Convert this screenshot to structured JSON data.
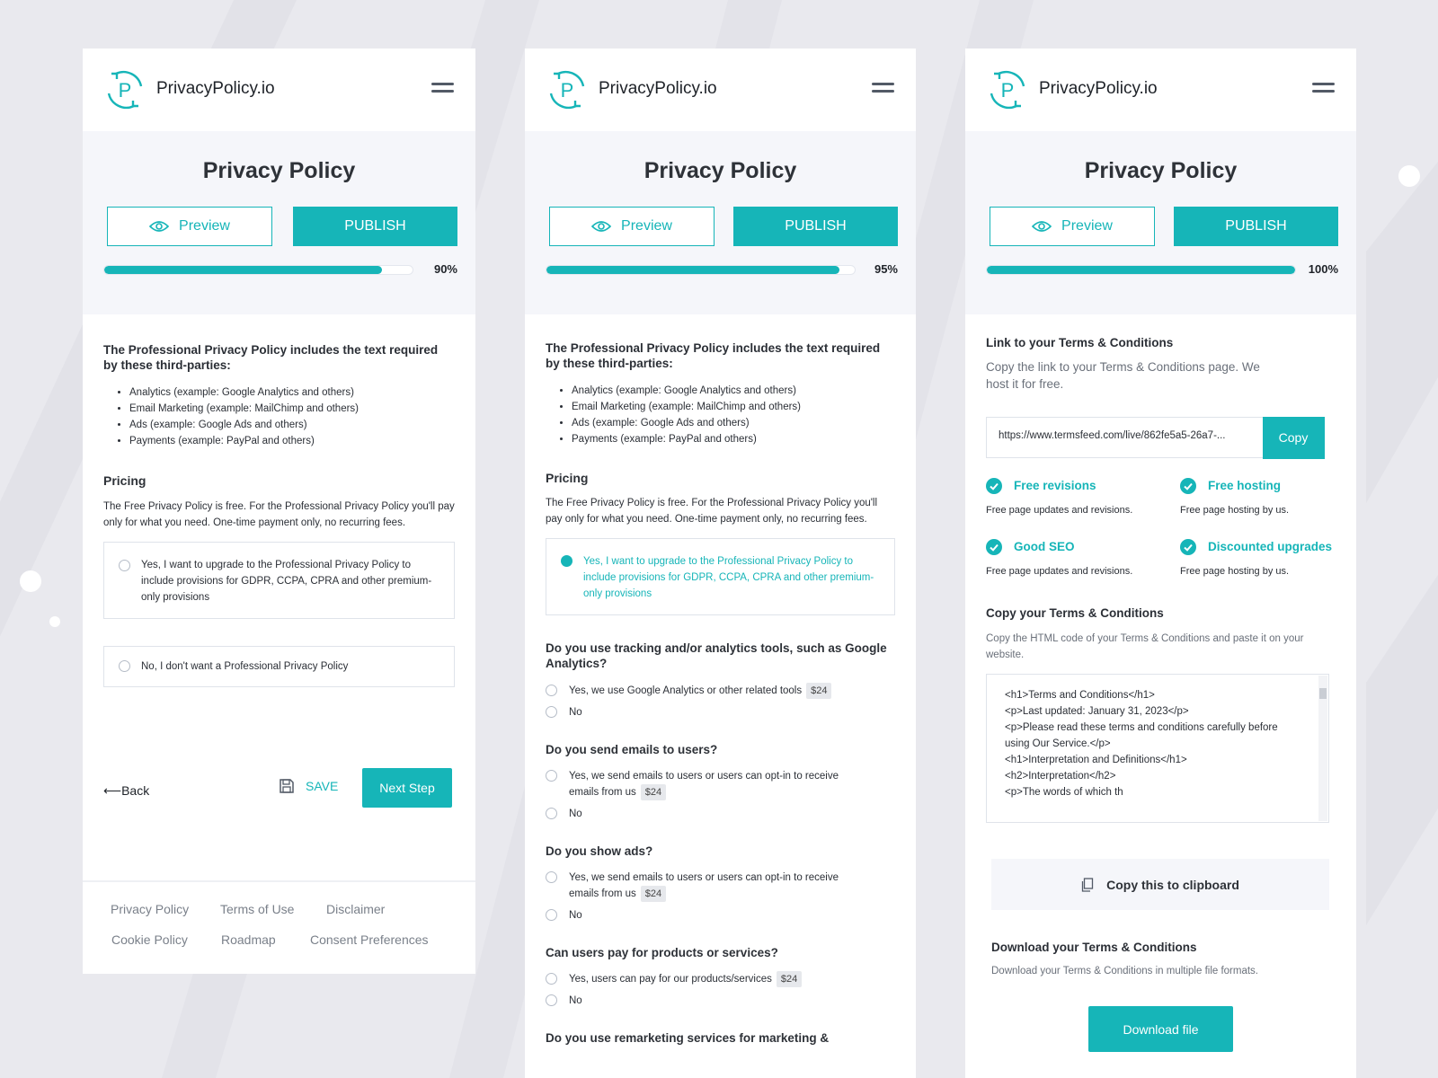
{
  "brand": "PrivacyPolicy.io",
  "colors": {
    "accent": "#16b5b8",
    "background": "#e9e9ee",
    "header_bg": "#f5f6fa"
  },
  "icons": [
    "logo-p-cycle",
    "hamburger-menu",
    "eye-icon",
    "save-disk-icon",
    "back-arrow",
    "check-circle",
    "clipboard-icon"
  ],
  "page_title": "Privacy Policy",
  "preview_label": "Preview",
  "publish_label": "PUBLISH",
  "screen1": {
    "progress": {
      "value": 90,
      "label": "90%"
    },
    "intro": "The Professional Privacy Policy includes the text required by these third-parties:",
    "third_parties": [
      "Analytics (example: Google Analytics and others)",
      "Email Marketing (example: MailChimp and others)",
      "Ads (example: Google Ads and others)",
      "Payments (example: PayPal and others)"
    ],
    "pricing_title": "Pricing",
    "pricing_text": "The Free Privacy Policy is free. For the Professional Privacy Policy you'll pay only for what you need. One-time payment only, no recurring fees.",
    "option_yes": "Yes, I want to upgrade to the Professional Privacy Policy to include provisions for GDPR, CCPA, CPRA and other premium-only provisions",
    "option_no": "No, I don't want a Professional Privacy Policy",
    "back_label": "Back",
    "back_arrow": "⟵",
    "save_label": "SAVE",
    "next_label": "Next Step",
    "footer_links": [
      "Privacy Policy",
      "Terms of Use",
      "Disclaimer",
      "Cookie Policy",
      "Roadmap",
      "Consent Preferences"
    ]
  },
  "screen2": {
    "progress": {
      "value": 95,
      "label": "95%"
    },
    "selected_option": "Yes, I want to upgrade to the Professional Privacy Policy to include provisions for GDPR, CCPA, CPRA and other premium-only provisions",
    "questions": [
      {
        "q": "Do you use tracking and/or analytics tools, such as Google Analytics?",
        "yes": "Yes, we use Google Analytics or other related tools",
        "price": "$24",
        "no": "No"
      },
      {
        "q": "Do you send emails to users?",
        "yes": "Yes, we send emails to users or users can opt-in to receive emails from us",
        "price": "$24",
        "no": "No"
      },
      {
        "q": "Do you show ads?",
        "yes": "Yes, we send emails to users or users can opt-in to receive emails from us",
        "price": "$24",
        "no": "No"
      },
      {
        "q": "Can users pay for products or services?",
        "yes": "Yes, users can pay for our products/services",
        "price": "$24",
        "no": "No"
      }
    ],
    "cut_question": "Do you use remarketing services for marketing &"
  },
  "screen3": {
    "progress": {
      "value": 100,
      "label": "100%"
    },
    "link_title": "Link to your Terms & Conditions",
    "link_desc": "Copy the link to your Terms & Conditions page. We host it for free.",
    "url": "https://www.termsfeed.com/live/862fe5a5-26a7-...",
    "copy_label": "Copy",
    "features": [
      {
        "title": "Free revisions",
        "text": "Free page updates and revisions."
      },
      {
        "title": "Free hosting",
        "text": "Free page hosting by us."
      },
      {
        "title": "Good SEO",
        "text": "Free page updates and revisions."
      },
      {
        "title": "Discounted upgrades",
        "text": "Free page hosting by us."
      }
    ],
    "copy_title": "Copy your Terms & Conditions",
    "copy_desc": "Copy the HTML code of your Terms & Conditions and paste it on your website.",
    "code": "<h1>Terms and Conditions</h1>\n<p>Last updated: January 31, 2023</p>\n<p>Please read these terms and conditions carefully before using Our Service.</p>\n<h1>Interpretation and Definitions</h1>\n<h2>Interpretation</h2>\n<p>The words of which th",
    "clipboard_label": "Copy this to clipboard",
    "download_title": "Download your Terms & Conditions",
    "download_desc": "Download your Terms & Conditions in multiple file formats.",
    "download_label": "Download file"
  }
}
